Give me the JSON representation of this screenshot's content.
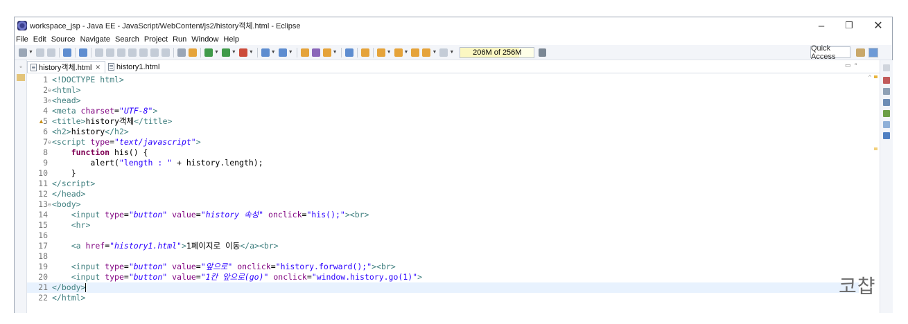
{
  "window": {
    "title": "workspace_jsp - Java EE - JavaScript/WebContent/js2/history객체.html - Eclipse",
    "minimize_glyph": "–",
    "maximize_glyph": "❐",
    "close_glyph": "✕"
  },
  "menu": [
    "File",
    "Edit",
    "Source",
    "Navigate",
    "Search",
    "Project",
    "Run",
    "Window",
    "Help"
  ],
  "toolbar": {
    "heap_status": "206M of 256M",
    "heap_used_fraction": 0.8,
    "quick_access": "Quick Access"
  },
  "tabs": [
    {
      "label": "history객체.html",
      "active": true,
      "close": "✕"
    },
    {
      "label": "history1.html",
      "active": false
    }
  ],
  "editor": {
    "lines": [
      {
        "n": "1",
        "fold": "",
        "html": "<span class=\"tag\">&lt;!DOCTYPE html&gt;</span>"
      },
      {
        "n": "2",
        "fold": "⊖",
        "html": "<span class=\"tag\">&lt;html&gt;</span>"
      },
      {
        "n": "3",
        "fold": "⊖",
        "html": "<span class=\"tag\">&lt;head&gt;</span>"
      },
      {
        "n": "4",
        "fold": "",
        "html": "<span class=\"tag\">&lt;meta </span><span class=\"attr\">charset</span><span class=\"plain\">=</span><span class=\"val\">\"UTF-8\"</span><span class=\"tag\">&gt;</span>"
      },
      {
        "n": "5",
        "fold": "",
        "html": "<span class=\"tag\">&lt;title&gt;</span><span class=\"plain\">history객체</span><span class=\"tag\">&lt;/title&gt;</span>"
      },
      {
        "n": "6",
        "fold": "",
        "html": "<span class=\"tag\">&lt;h2&gt;</span><span class=\"plain\">history</span><span class=\"tag\">&lt;/h2&gt;</span>"
      },
      {
        "n": "7",
        "fold": "⊖",
        "html": "<span class=\"tag\">&lt;script </span><span class=\"attr\">type</span><span class=\"plain\">=</span><span class=\"val\">\"text/javascript\"</span><span class=\"tag\">&gt;</span>"
      },
      {
        "n": "8",
        "fold": "",
        "html": "    <span class=\"kw\">function</span><span class=\"plain\"> his() {</span>"
      },
      {
        "n": "9",
        "fold": "",
        "html": "        <span class=\"plain\">alert(</span><span class=\"str\">\"length : \"</span><span class=\"plain\"> + history.length);</span>"
      },
      {
        "n": "10",
        "fold": "",
        "html": "    <span class=\"plain\">}</span>"
      },
      {
        "n": "11",
        "fold": "",
        "html": "<span class=\"tag\">&lt;/script&gt;</span>"
      },
      {
        "n": "12",
        "fold": "",
        "html": "<span class=\"tag\">&lt;/head&gt;</span>"
      },
      {
        "n": "13",
        "fold": "⊖",
        "html": "<span class=\"tag\">&lt;body&gt;</span>"
      },
      {
        "n": "14",
        "fold": "",
        "html": "    <span class=\"tag\">&lt;input </span><span class=\"attr\">type</span><span class=\"plain\">=</span><span class=\"val\">\"button\"</span><span class=\"plain\"> </span><span class=\"attr\">value</span><span class=\"plain\">=</span><span class=\"val\">\"history 속성\"</span><span class=\"plain\"> </span><span class=\"attr\">onclick</span><span class=\"plain\">=</span><span class=\"str\">\"his();\"</span><span class=\"tag\">&gt;&lt;br&gt;</span>"
      },
      {
        "n": "15",
        "fold": "",
        "html": "    <span class=\"tag\">&lt;hr&gt;</span>"
      },
      {
        "n": "16",
        "fold": "",
        "html": ""
      },
      {
        "n": "17",
        "fold": "",
        "html": "    <span class=\"tag\">&lt;a </span><span class=\"attr\">href</span><span class=\"plain\">=</span><span class=\"val\">\"history1.html\"</span><span class=\"tag\">&gt;</span><span class=\"plain\">1페이지로 이동</span><span class=\"tag\">&lt;/a&gt;&lt;br&gt;</span>"
      },
      {
        "n": "18",
        "fold": "",
        "html": ""
      },
      {
        "n": "19",
        "fold": "",
        "html": "    <span class=\"tag\">&lt;input </span><span class=\"attr\">type</span><span class=\"plain\">=</span><span class=\"val\">\"button\"</span><span class=\"plain\"> </span><span class=\"attr\">value</span><span class=\"plain\">=</span><span class=\"val\">\"앞으로\"</span><span class=\"plain\"> </span><span class=\"attr\">onclick</span><span class=\"plain\">=</span><span class=\"str\">\"history.forward();\"</span><span class=\"tag\">&gt;&lt;br&gt;</span>"
      },
      {
        "n": "20",
        "fold": "",
        "html": "    <span class=\"tag\">&lt;input </span><span class=\"attr\">type</span><span class=\"plain\">=</span><span class=\"val\">\"button\"</span><span class=\"plain\"> </span><span class=\"attr\">value</span><span class=\"plain\">=</span><span class=\"val\">\"1칸 앞으로(go)\"</span><span class=\"plain\"> </span><span class=\"attr\">onclick</span><span class=\"plain\">=</span><span class=\"str\">\"window.history.go(1)\"</span><span class=\"tag\">&gt;</span>"
      },
      {
        "n": "21",
        "fold": "",
        "html": "<span class=\"tag\">&lt;/body&gt;</span><span class=\"caret\"></span>",
        "current": true
      },
      {
        "n": "22",
        "fold": "",
        "html": "<span class=\"tag\">&lt;/html&gt;</span>"
      }
    ]
  },
  "watermark": "코챱"
}
